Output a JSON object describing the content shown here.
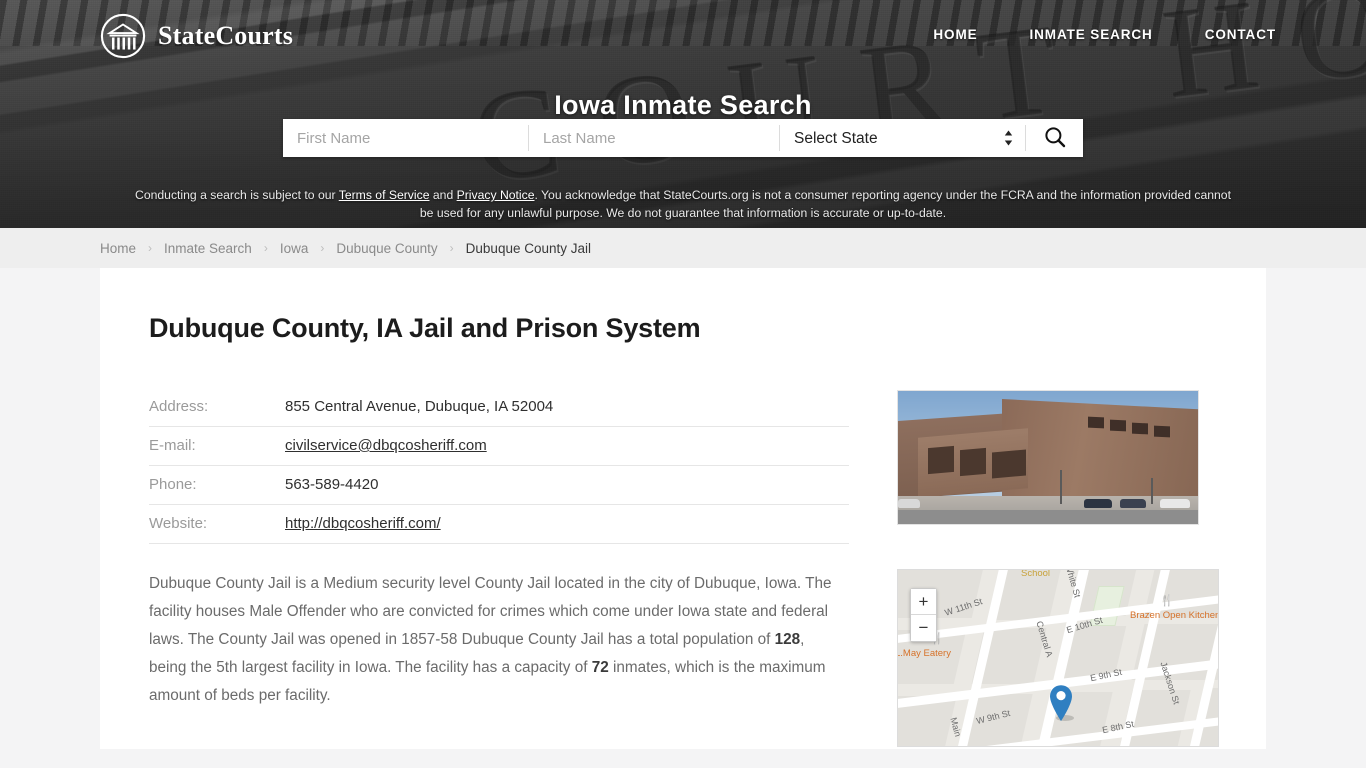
{
  "site": {
    "brand_name": "StateCourts",
    "logo_icon": "courthouse-circle-logo"
  },
  "nav": {
    "items": [
      {
        "label": "HOME"
      },
      {
        "label": "INMATE SEARCH"
      },
      {
        "label": "CONTACT"
      }
    ]
  },
  "hero": {
    "title": "Iowa Inmate Search",
    "background_image": "courthouse-facade-engraved-COURT-HOUSE",
    "engraved_text": "COURT HOUSE"
  },
  "search": {
    "first_name_value": "",
    "first_name_placeholder": "First Name",
    "last_name_value": "",
    "last_name_placeholder": "Last Name",
    "state_selected": "Select State",
    "state_options": [
      "Select State"
    ],
    "search_icon": "magnifier-icon",
    "spinner_icon": "chevron-up-down-icon"
  },
  "disclaimer": {
    "part1": "Conducting a search is subject to our ",
    "link_terms": "Terms of Service",
    "part2": " and ",
    "link_privacy": "Privacy Notice",
    "part3": ". You acknowledge that StateCourts.org is not a consumer reporting agency under the FCRA and the information provided cannot be used for any unlawful purpose. We do not guarantee that information is accurate or up-to-date."
  },
  "breadcrumb": {
    "separator": "›",
    "items": [
      {
        "label": "Home",
        "current": false
      },
      {
        "label": "Inmate Search",
        "current": false
      },
      {
        "label": "Iowa",
        "current": false
      },
      {
        "label": "Dubuque County",
        "current": false
      },
      {
        "label": "Dubuque County Jail",
        "current": true
      }
    ]
  },
  "facility": {
    "title": "Dubuque County, IA Jail and Prison System",
    "info": [
      {
        "label": "Address:",
        "value": "855 Central Avenue, Dubuque, IA 52004",
        "is_link": false
      },
      {
        "label": "E-mail:",
        "value": "civilservice@dbqcosheriff.com",
        "is_link": true
      },
      {
        "label": "Phone:",
        "value": "563-589-4420",
        "is_link": false
      },
      {
        "label": "Website:",
        "value": "http://dbqcosheriff.com/",
        "is_link": true
      }
    ],
    "description": {
      "seg1": "Dubuque County Jail is a Medium security level County Jail located in the city of Dubuque, Iowa. The facility houses Male Offender who are convicted for crimes which come under Iowa state and federal laws. The County Jail was opened in 1857-58 Dubuque County Jail has a total population of ",
      "population": "128",
      "seg2": ", being the 5th largest facility in Iowa. The facility has a capacity of ",
      "capacity": "72",
      "seg3": " inmates, which is the maximum amount of beds per facility."
    },
    "photo_alt": "Dubuque County Jail building street view"
  },
  "map": {
    "zoom_in_label": "+",
    "zoom_out_label": "−",
    "pin_icon": "map-pin-icon",
    "pin_color": "#2f7fc1",
    "streets": [
      {
        "name": "W 11th St"
      },
      {
        "name": "White St"
      },
      {
        "name": "E 10th St"
      },
      {
        "name": "Central A"
      },
      {
        "name": "E 9th St"
      },
      {
        "name": "W 9th St"
      },
      {
        "name": "E 8th St"
      },
      {
        "name": "Jackson St"
      },
      {
        "name": "Main"
      }
    ],
    "pois": [
      {
        "name": "School"
      },
      {
        "name": "Brazen Open Kitchen | Bar"
      },
      {
        "name": "L.May Eatery"
      }
    ]
  }
}
